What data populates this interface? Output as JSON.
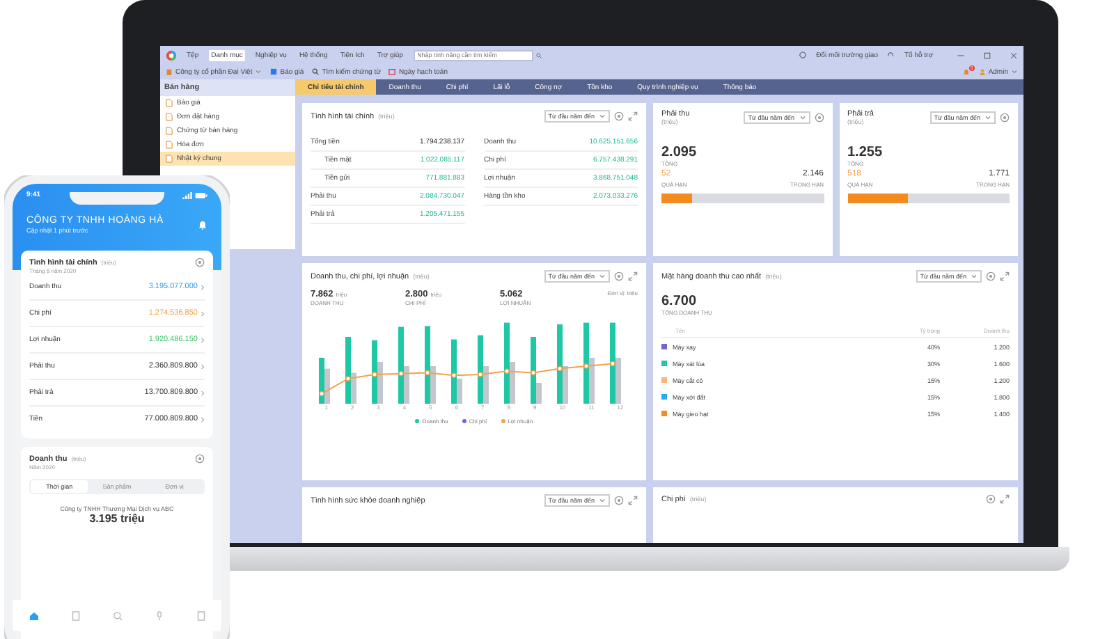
{
  "app": {
    "menu": [
      {
        "label": "Tệp",
        "selected": false
      },
      {
        "label": "Danh mục",
        "selected": true
      },
      {
        "label": "Nghiệp vụ",
        "selected": false
      },
      {
        "label": "Hệ thống",
        "selected": false
      },
      {
        "label": "Tiện ích",
        "selected": false
      },
      {
        "label": "Trợ giúp",
        "selected": false
      }
    ],
    "search": {
      "placeholder": "Nhập tính năng cần tìm kiếm"
    },
    "header_links": [
      "Đổi môi trường giao",
      "Tổ hỗ trợ"
    ],
    "toolbar": {
      "company": "Công ty cổ phần Đại Việt",
      "items": [
        "Báo giá",
        "Tìm kiếm chứng từ",
        "Ngày hạch toán"
      ],
      "notification_count": "5",
      "user": "Admin"
    },
    "sidebar": {
      "title": "Bán hàng",
      "items": [
        {
          "label": "Báo giá",
          "selected": false
        },
        {
          "label": "Đơn đặt hàng",
          "selected": false
        },
        {
          "label": "Chứng từ bán hàng",
          "selected": false
        },
        {
          "label": "Hóa đơn",
          "selected": false
        },
        {
          "label": "Nhật ký chung",
          "selected": true
        }
      ]
    },
    "tabs": [
      {
        "label": "Chỉ tiêu tài chính",
        "selected": true
      },
      {
        "label": "Doanh thu",
        "selected": false
      },
      {
        "label": "Chi phí",
        "selected": false
      },
      {
        "label": "Lãi lỗ",
        "selected": false
      },
      {
        "label": "Công nợ",
        "selected": false
      },
      {
        "label": "Tồn kho",
        "selected": false
      },
      {
        "label": "Quy trình nghiệp vụ",
        "selected": false
      },
      {
        "label": "Thông báo",
        "selected": false
      }
    ],
    "finance": {
      "title": "Tình hình tài chính",
      "unit": "(triệu)",
      "period": "Từ đầu năm đến",
      "left": [
        {
          "label": "Tổng tiền",
          "value": "1.794.238.137",
          "children": [
            {
              "label": "Tiền mặt",
              "value": "1.022.085.117"
            },
            {
              "label": "Tiền gửi",
              "value": "771.881.883"
            }
          ]
        },
        {
          "label": "Phải thu",
          "value": "2.084.730.047"
        },
        {
          "label": "Phải trả",
          "value": "1.205.471.155"
        }
      ],
      "right": [
        {
          "label": "Doanh thu",
          "value": "10.625.151.656"
        },
        {
          "label": "Chi phí",
          "value": "6.757.438.291"
        },
        {
          "label": "Lợi nhuận",
          "value": "3.868.751.048"
        },
        {
          "label": "Hàng tồn kho",
          "value": "2.073.033.276"
        }
      ]
    },
    "debts": [
      {
        "title": "Phải thu",
        "unit": "(triệu)",
        "period": "Từ đầu năm đến",
        "total": "2.095",
        "total_label": "TỔNG",
        "overdue": "52",
        "overdue_label": "QUÁ HẠN",
        "in_term": "2.146",
        "in_term_label": "TRONG HẠN",
        "level": 0.19
      },
      {
        "title": "Phải trả",
        "unit": "(triệu)",
        "period": "Từ đầu năm đến",
        "total": "1.255",
        "total_label": "TỔNG",
        "overdue": "518",
        "overdue_label": "QUÁ HẠN",
        "in_term": "1.771",
        "in_term_label": "TRONG HẠN",
        "level": 0.37
      }
    ],
    "revenue_chart": {
      "title": "Doanh thu, chi phí, lợi nhuận",
      "unit": "(triệu)",
      "period": "Từ đầu năm đến",
      "unit_note": "Đơn vị: triệu",
      "stats": [
        {
          "value": "7.862",
          "unit": "triệu",
          "label": "DOANH THU"
        },
        {
          "value": "2.800",
          "unit": "triệu",
          "label": "CHI PHÍ"
        },
        {
          "value": "5.062",
          "label": "LỢI NHUẬN"
        }
      ],
      "months": [
        "1",
        "2",
        "3",
        "4",
        "5",
        "6",
        "7",
        "8",
        "9",
        "10",
        "11",
        "12"
      ],
      "legend": [
        {
          "label": "Doanh thu",
          "color": "#1ec8a5"
        },
        {
          "label": "Chi phí",
          "color": "#7b61d9"
        },
        {
          "label": "Lợi nhuận",
          "color": "#f5a04a"
        }
      ]
    },
    "top_products": {
      "title": "Mặt hàng doanh thu cao nhất",
      "unit": "(triệu)",
      "period": "Từ đầu năm đến",
      "total": "6.700",
      "total_label": "TỔNG DOANH THU",
      "columns": [
        "Tên",
        "Tỷ trọng",
        "Doanh thu"
      ],
      "rows": [
        {
          "name": "Máy xay",
          "share": "40%",
          "revenue": "1.200",
          "color": "#7b61d9"
        },
        {
          "name": "Máy xát lúa",
          "share": "30%",
          "revenue": "1.600",
          "color": "#1ec8a5"
        },
        {
          "name": "Máy cắt cỏ",
          "share": "15%",
          "revenue": "1.200",
          "color": "#ffb37a"
        },
        {
          "name": "Máy xới đất",
          "share": "15%",
          "revenue": "1.800",
          "color": "#2aa7f5"
        },
        {
          "name": "Máy gieo hạt",
          "share": "15%",
          "revenue": "1.400",
          "color": "#f58a2a"
        }
      ]
    },
    "health": {
      "title": "Tình hình sức khỏe doanh nghiệp",
      "period": "Từ đầu năm đến"
    },
    "costs": {
      "title": "Chi phí",
      "unit": "(triệu)"
    }
  },
  "phone": {
    "time": "9:41",
    "company": "CÔNG TY TNHH HOÀNG HÀ",
    "updated": "Cập nhật 1 phút trước",
    "finance": {
      "title": "Tình hình tài chính",
      "unit": "(triệu)",
      "period": "Tháng 8 năm 2020",
      "rows": [
        {
          "label": "Doanh thu",
          "value": "3.195.077.000",
          "color": "#2a9df4"
        },
        {
          "label": "Chi phí",
          "value": "1.274.536.850",
          "color": "#f5a04a"
        },
        {
          "label": "Lợi nhuận",
          "value": "1.920.486.150",
          "color": "#3cc46a"
        },
        {
          "label": "Phải thu",
          "value": "2.360.809.800",
          "color": "#333333"
        },
        {
          "label": "Phải trả",
          "value": "13.700.809.800",
          "color": "#333333"
        },
        {
          "label": "Tiền",
          "value": "77.000.809.800",
          "color": "#333333"
        }
      ]
    },
    "revenue": {
      "title": "Doanh thu",
      "unit": "(triệu)",
      "period": "Năm 2020",
      "segments": [
        {
          "label": "Thời gian",
          "selected": true
        },
        {
          "label": "Sản phẩm",
          "selected": false
        },
        {
          "label": "Đơn vị",
          "selected": false
        }
      ],
      "company": "Công ty TNHH Thương Mại Dịch vụ ABC",
      "amount": "3.195 triệu"
    }
  }
}
